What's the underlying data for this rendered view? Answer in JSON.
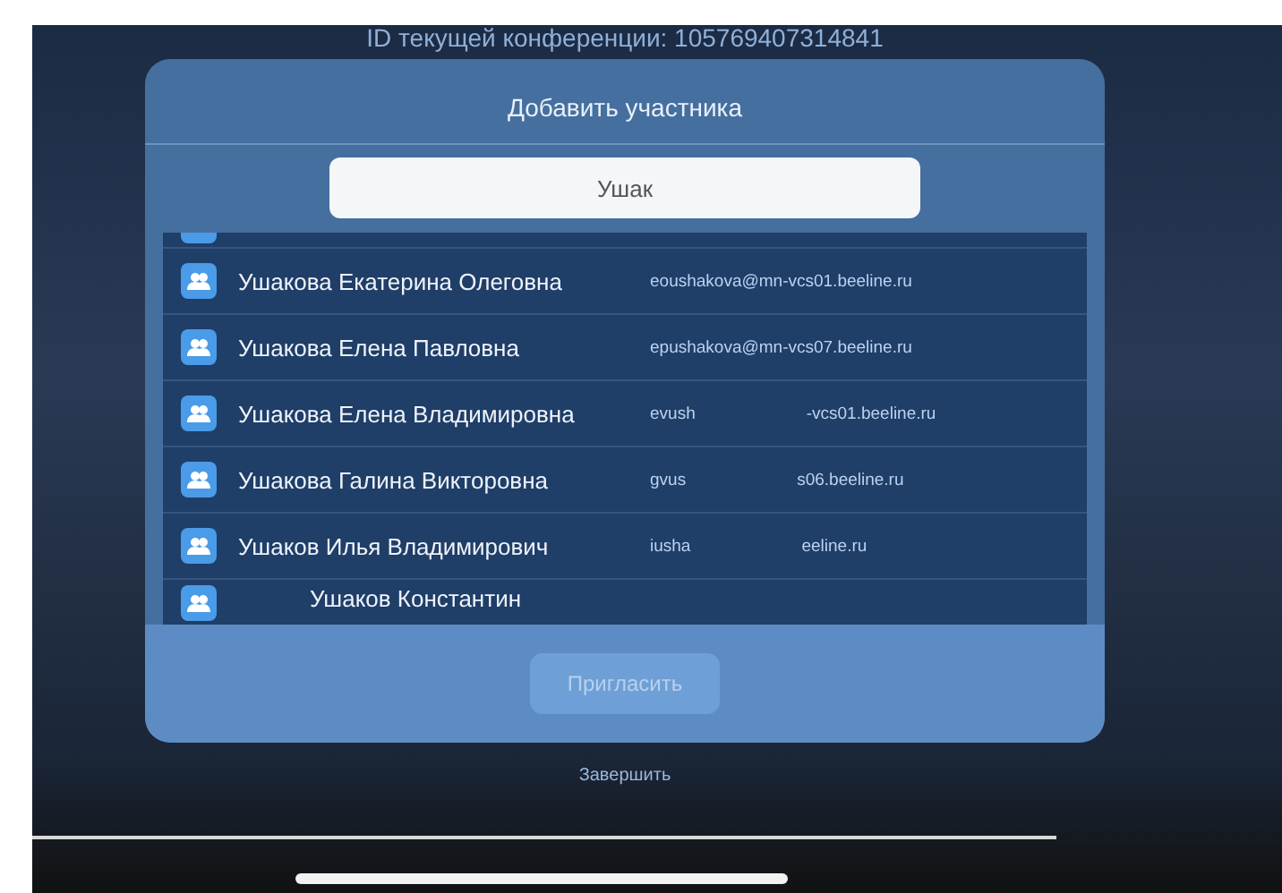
{
  "conference_id": "ID текущей конференции: 105769407314841",
  "dialog": {
    "title": "Добавить участника",
    "search": {
      "value": "Ушак"
    },
    "contacts": [
      {
        "name": "Ушакова Екатерина Олеговна",
        "email": [
          "eoushakova@mn-vcs01.beeline.ru"
        ]
      },
      {
        "name": "Ушакова Елена Павловна",
        "email": [
          "epushakova@mn-vcs07.beeline.ru"
        ]
      },
      {
        "name": "Ушакова Елена Владимировна",
        "email": [
          "evush",
          "-vcs01.beeline.ru"
        ]
      },
      {
        "name": "Ушакова Галина Викторовна",
        "email": [
          "gvus",
          "s06.beeline.ru"
        ]
      },
      {
        "name": "Ушаков Илья Владимирович",
        "email": [
          "iusha",
          "eeline.ru"
        ]
      },
      {
        "name": "Ушаков Константин"
      }
    ],
    "invite_button": {
      "label": "Пригласить",
      "disabled": true
    }
  },
  "end_call": "Завершить"
}
